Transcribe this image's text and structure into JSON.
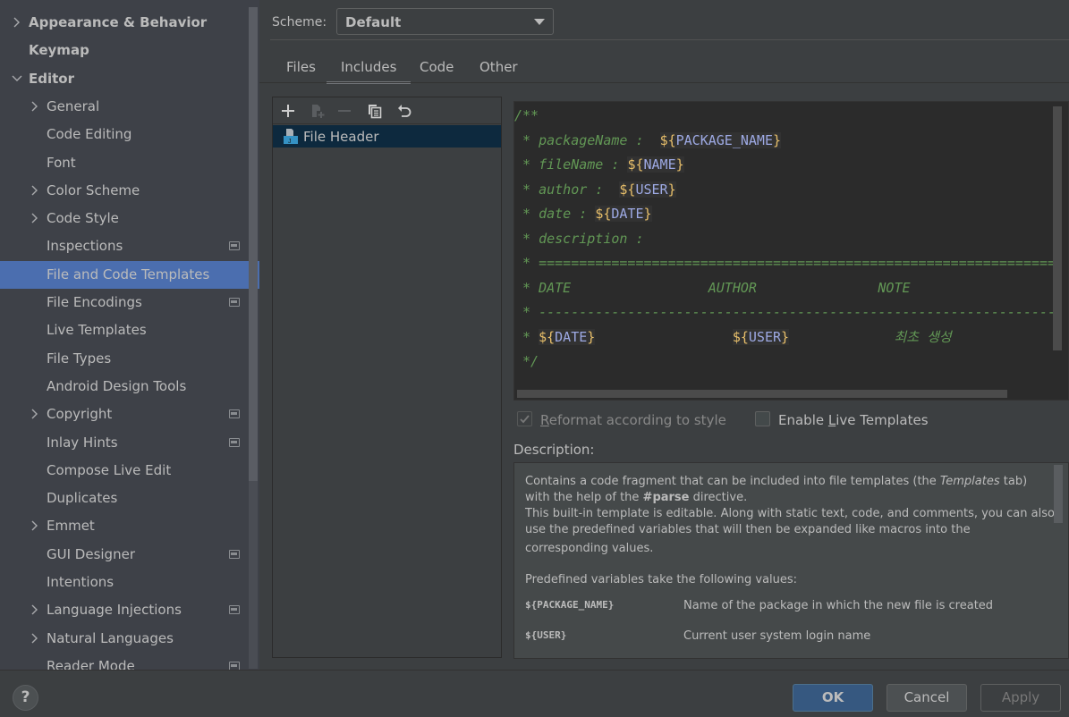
{
  "sidebar": {
    "items": [
      {
        "label": "Appearance & Behavior",
        "level": 0,
        "expander": "collapsed",
        "bold": true,
        "project_badge": false,
        "selected": false
      },
      {
        "label": "Keymap",
        "level": 0,
        "expander": "none",
        "bold": true,
        "project_badge": false,
        "selected": false
      },
      {
        "label": "Editor",
        "level": 0,
        "expander": "expanded",
        "bold": true,
        "project_badge": false,
        "selected": false
      },
      {
        "label": "General",
        "level": 1,
        "expander": "collapsed",
        "bold": false,
        "project_badge": false,
        "selected": false
      },
      {
        "label": "Code Editing",
        "level": 1,
        "expander": "none",
        "bold": false,
        "project_badge": false,
        "selected": false
      },
      {
        "label": "Font",
        "level": 1,
        "expander": "none",
        "bold": false,
        "project_badge": false,
        "selected": false
      },
      {
        "label": "Color Scheme",
        "level": 1,
        "expander": "collapsed",
        "bold": false,
        "project_badge": false,
        "selected": false
      },
      {
        "label": "Code Style",
        "level": 1,
        "expander": "collapsed",
        "bold": false,
        "project_badge": false,
        "selected": false
      },
      {
        "label": "Inspections",
        "level": 1,
        "expander": "none",
        "bold": false,
        "project_badge": true,
        "selected": false
      },
      {
        "label": "File and Code Templates",
        "level": 1,
        "expander": "none",
        "bold": false,
        "project_badge": false,
        "selected": true
      },
      {
        "label": "File Encodings",
        "level": 1,
        "expander": "none",
        "bold": false,
        "project_badge": true,
        "selected": false
      },
      {
        "label": "Live Templates",
        "level": 1,
        "expander": "none",
        "bold": false,
        "project_badge": false,
        "selected": false
      },
      {
        "label": "File Types",
        "level": 1,
        "expander": "none",
        "bold": false,
        "project_badge": false,
        "selected": false
      },
      {
        "label": "Android Design Tools",
        "level": 1,
        "expander": "none",
        "bold": false,
        "project_badge": false,
        "selected": false
      },
      {
        "label": "Copyright",
        "level": 1,
        "expander": "collapsed",
        "bold": false,
        "project_badge": true,
        "selected": false
      },
      {
        "label": "Inlay Hints",
        "level": 1,
        "expander": "none",
        "bold": false,
        "project_badge": true,
        "selected": false
      },
      {
        "label": "Compose Live Edit",
        "level": 1,
        "expander": "none",
        "bold": false,
        "project_badge": false,
        "selected": false
      },
      {
        "label": "Duplicates",
        "level": 1,
        "expander": "none",
        "bold": false,
        "project_badge": false,
        "selected": false
      },
      {
        "label": "Emmet",
        "level": 1,
        "expander": "collapsed",
        "bold": false,
        "project_badge": false,
        "selected": false
      },
      {
        "label": "GUI Designer",
        "level": 1,
        "expander": "none",
        "bold": false,
        "project_badge": true,
        "selected": false
      },
      {
        "label": "Intentions",
        "level": 1,
        "expander": "none",
        "bold": false,
        "project_badge": false,
        "selected": false
      },
      {
        "label": "Language Injections",
        "level": 1,
        "expander": "collapsed",
        "bold": false,
        "project_badge": true,
        "selected": false
      },
      {
        "label": "Natural Languages",
        "level": 1,
        "expander": "collapsed",
        "bold": false,
        "project_badge": false,
        "selected": false
      },
      {
        "label": "Reader Mode",
        "level": 1,
        "expander": "none",
        "bold": false,
        "project_badge": true,
        "selected": false
      }
    ]
  },
  "scheme": {
    "label": "Scheme:",
    "value": "Default"
  },
  "tabs": [
    {
      "label": "Files",
      "active": false
    },
    {
      "label": "Includes",
      "active": true
    },
    {
      "label": "Code",
      "active": false
    },
    {
      "label": "Other",
      "active": false
    }
  ],
  "toolbar": {
    "icons": [
      "plus-icon",
      "new-child-file-icon",
      "minus-icon",
      "copy-icon",
      "revert-icon"
    ],
    "disabled": [
      "new-child-file-icon",
      "minus-icon"
    ]
  },
  "templates": [
    {
      "name": "File Header",
      "icon": "java-file-icon",
      "selected": true
    }
  ],
  "editor": {
    "lines": [
      [
        {
          "t": "/**",
          "k": "c"
        }
      ],
      [
        {
          "t": " * packageName :  ",
          "k": "c"
        },
        {
          "v": "PACKAGE_NAME"
        }
      ],
      [
        {
          "t": " * fileName : ",
          "k": "c"
        },
        {
          "v": "NAME"
        }
      ],
      [
        {
          "t": " * author :  ",
          "k": "c"
        },
        {
          "v": "USER"
        }
      ],
      [
        {
          "t": " * date : ",
          "k": "c"
        },
        {
          "v": "DATE"
        }
      ],
      [
        {
          "t": " * description :",
          "k": "c"
        }
      ],
      [
        {
          "t": " * ================================================================",
          "k": "c"
        }
      ],
      [
        {
          "t": " * DATE                 AUTHOR               NOTE",
          "k": "c"
        }
      ],
      [
        {
          "t": " * ----------------------------------------------------------------",
          "k": "c"
        }
      ],
      [
        {
          "t": " * ",
          "k": "c"
        },
        {
          "v": "DATE"
        },
        {
          "t": "                 ",
          "k": "c"
        },
        {
          "v": "USER"
        },
        {
          "t": "             최초 생성",
          "k": "c"
        }
      ],
      [
        {
          "t": " */",
          "k": "c"
        }
      ]
    ]
  },
  "options": {
    "reformat": {
      "label_pre": "",
      "mnemonic": "R",
      "label_post": "eformat according to style",
      "checked": true,
      "enabled": false
    },
    "live_templates": {
      "label_pre": "Enable ",
      "mnemonic": "L",
      "label_post": "ive Templates",
      "checked": false,
      "enabled": true
    }
  },
  "description": {
    "label": "Description:",
    "line1_a": "Contains a code fragment that can be included into file templates (the ",
    "line1_em": "Templates",
    "line1_b": " tab)",
    "line2_a": "with the help of the ",
    "line2_strong": "#parse",
    "line2_b": " directive.",
    "line3": "This built-in template is editable. Along with static text, code, and comments, you can also",
    "line4": "use the predefined variables that will then be expanded like macros into the",
    "line5": "corresponding values.",
    "predefined": "Predefined variables take the following values:",
    "vars": [
      {
        "name": "${PACKAGE_NAME}",
        "desc": "Name of the package in which the new file is created"
      },
      {
        "name": "${USER}",
        "desc": "Current user system login name"
      }
    ]
  },
  "footer": {
    "help": "?",
    "ok": "OK",
    "cancel": "Cancel",
    "apply": "Apply"
  }
}
